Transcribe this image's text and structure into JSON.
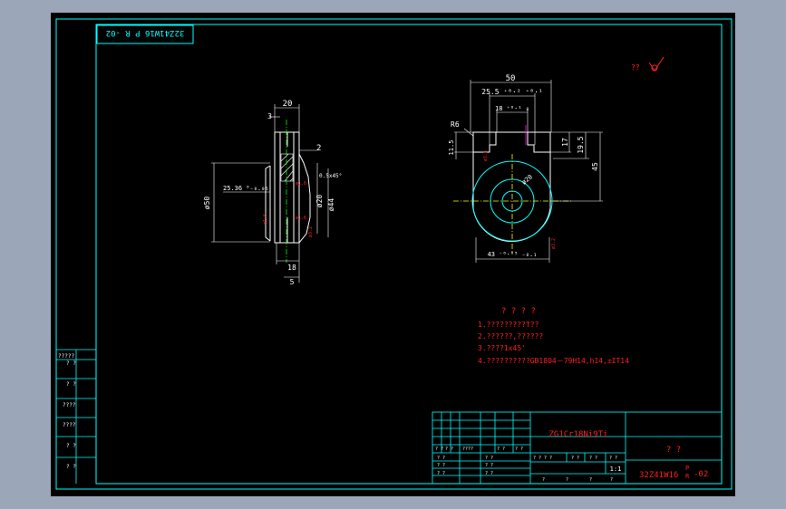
{
  "viewport_bg": "#9ba7b8",
  "colors": {
    "frame": "#00ffff",
    "part": "#ffffff",
    "dim": "#ffffff",
    "red": "#ff2020",
    "magenta": "#ff00ff",
    "green": "#00ff00",
    "yellow": "#ffff00",
    "paper": "#000000"
  },
  "corner_code": "32Z41W16 P R -02",
  "roughness_symbol": "??",
  "left_view": {
    "dims": {
      "top_width": "20",
      "top_small": "3",
      "slot": "2",
      "diameter_50": "ø50",
      "diameter_25": "25.36 ⁰₋₀.₀₅",
      "diameter_20": "ø20",
      "diameter_44": "ø44",
      "tol_chamfer": "0.5x45°",
      "bottom_18": "18",
      "bottom_5": "5",
      "small_a": "ø1.6",
      "small_b": "ø1.6",
      "small_c": "ø1.6",
      "small_d": "ø3.2"
    }
  },
  "right_view": {
    "dims": {
      "width_50": "50",
      "width_25": "25.5 ⁺⁰·² ⁺⁰·¹",
      "width_18": "18 ⁺⁰·¹ ₀",
      "r6": "R6",
      "h11": "11.5",
      "h17": "17",
      "h19": "19.5",
      "h45": "45",
      "dia_20": "ø20",
      "bottom": "43 ⁻⁰·⁰⁵ ₋₀.₁",
      "tol_left": "ø1.6",
      "tol_bottom": "ø3.2"
    }
  },
  "notes": {
    "title": "? ? ? ?",
    "lines": [
      "1.?????????T??",
      "2.??????,??????",
      "3.????1x45'",
      "4.??????????GB1804－79H14,h14,±IT14"
    ]
  },
  "side_table": {
    "rows": [
      "?????",
      "?  ?",
      "?  ?",
      "????",
      "????",
      "?  ?",
      "?  ?"
    ]
  },
  "title_block": {
    "material": "ZG1Cr18Ni9Ti",
    "name": "?   ?",
    "scale": "1:1",
    "code": "32Z41W16",
    "code_suffix_p": "P",
    "code_suffix_r": "R",
    "code_tail": "-02",
    "header_labels": [
      "? ?",
      "? ?",
      "????",
      "? ?",
      "? ?"
    ],
    "bottom_labels": [
      "?",
      "?",
      "?",
      "?"
    ],
    "right_labels": [
      "? ? ? ?",
      "? ?",
      "? ?",
      "? ?"
    ],
    "left_rows": [
      [
        "? ?",
        "? ?"
      ],
      [
        "? ?",
        "? ?"
      ],
      [
        "? ?",
        "? ?"
      ]
    ]
  }
}
